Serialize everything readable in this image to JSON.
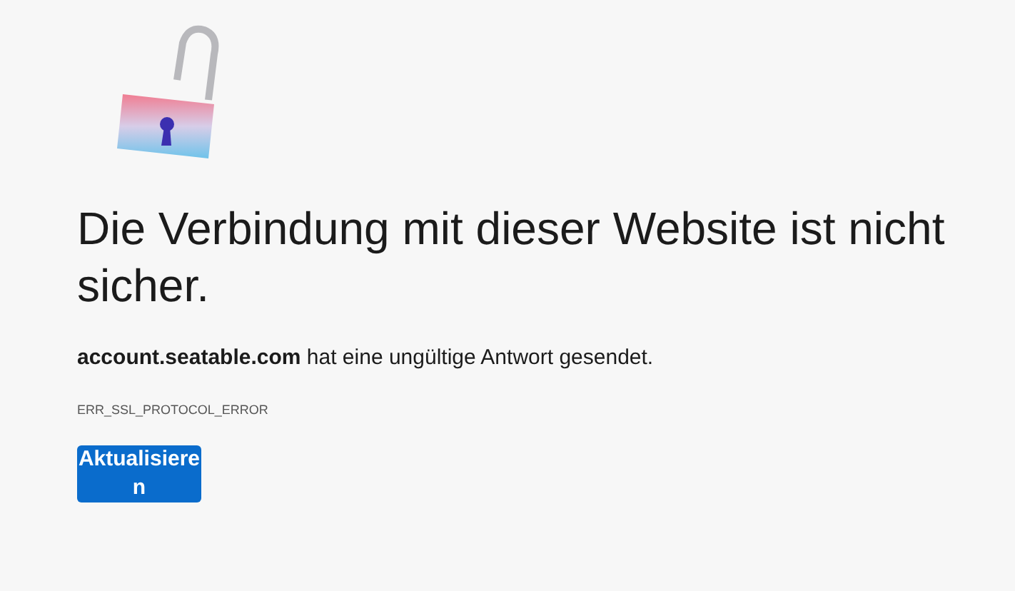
{
  "title": "Die Verbindung mit dieser Website ist nicht sicher.",
  "message": "**account.seatable.com** hat eine ungültige Antwort gesendet.",
  "error_code": "ERR_SSL_PROTOCOL_ERROR",
  "buttons": [
    "Aktualisieren"
  ]
}
